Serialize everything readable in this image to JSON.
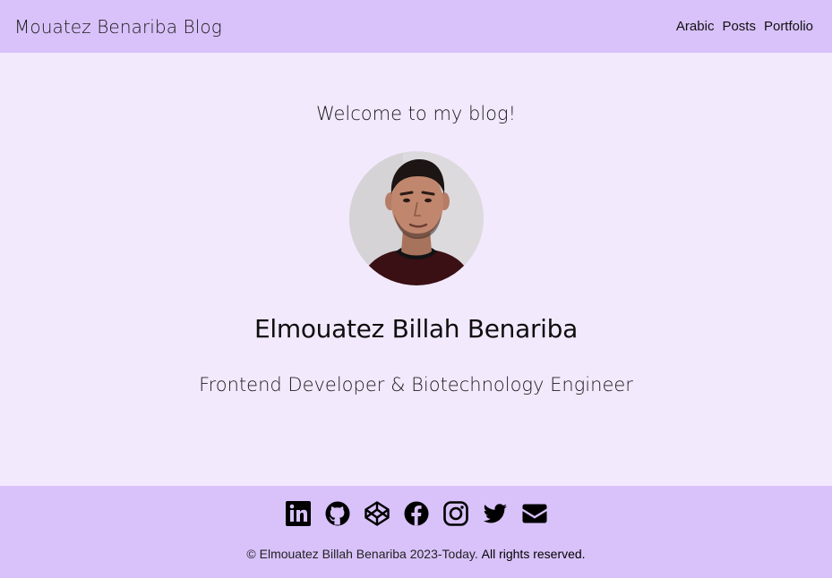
{
  "header": {
    "site_title": "Mouatez Benariba Blog",
    "nav": [
      {
        "label": "Arabic"
      },
      {
        "label": "Posts"
      },
      {
        "label": "Portfolio"
      }
    ]
  },
  "main": {
    "welcome": "Welcome to my blog!",
    "avatar_alt": "profile photo",
    "name": "Elmouatez Billah Benariba",
    "role": "Frontend Developer & Biotechnology Engineer"
  },
  "footer": {
    "socials": [
      {
        "icon": "linkedin-icon"
      },
      {
        "icon": "github-icon"
      },
      {
        "icon": "codepen-icon"
      },
      {
        "icon": "facebook-icon"
      },
      {
        "icon": "instagram-icon"
      },
      {
        "icon": "twitter-icon"
      },
      {
        "icon": "email-icon"
      }
    ],
    "copyright_prefix": "© Elmouatez Billah Benariba 2023-Today.",
    "copyright_suffix": "All rights reserved."
  },
  "colors": {
    "header_bg": "#d9c2fa",
    "page_bg": "#f3e9fd",
    "text": "#111111"
  }
}
